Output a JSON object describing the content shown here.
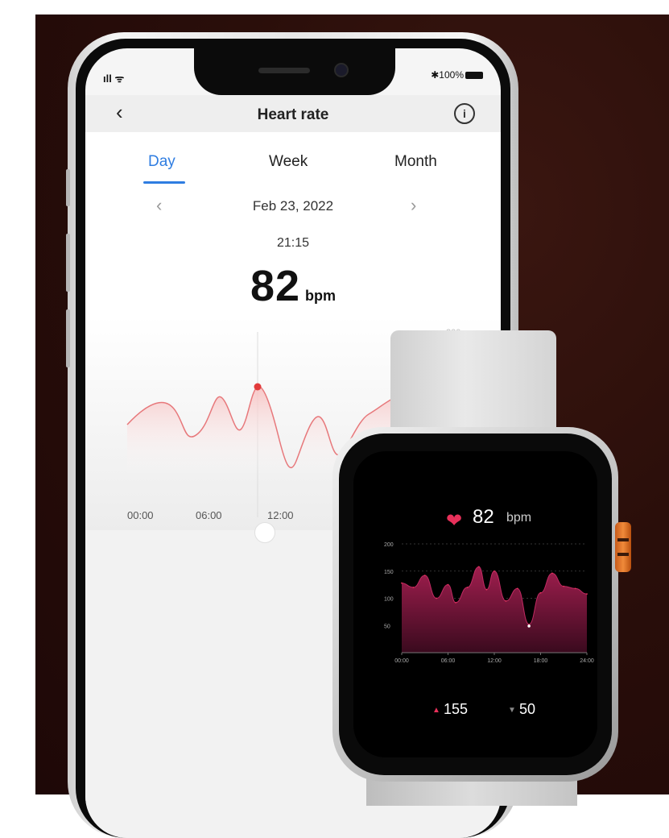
{
  "status_bar": {
    "signal": "ıll ᯤ",
    "battery": "✱100%"
  },
  "header": {
    "back_icon": "‹",
    "title": "Heart rate",
    "info_icon": "i"
  },
  "tabs": [
    {
      "label": "Day",
      "active": true
    },
    {
      "label": "Week"
    },
    {
      "label": "Month"
    }
  ],
  "date_nav": {
    "prev": "‹",
    "date": "Feb 23, 2022",
    "next": "›"
  },
  "reading": {
    "time": "21:15",
    "value": "82",
    "unit": "bpm"
  },
  "chart": {
    "x_ticks": [
      "00:00",
      "06:00",
      "12:00"
    ],
    "y_partial": "200",
    "line_color": "#e7787b",
    "fill_color": "#f9d3d3"
  },
  "watch": {
    "heart_icon": "❤",
    "value": "82",
    "unit": "bpm",
    "chart_data": {
      "type": "area",
      "y_ticks": [
        "200",
        "150",
        "100",
        "50"
      ],
      "x_ticks": [
        "00:00",
        "06:00",
        "12:00",
        "18:00",
        "24:00"
      ],
      "ylim": [
        0,
        200
      ],
      "x": [
        0,
        1.5,
        3,
        4.5,
        6,
        7,
        8.5,
        10,
        11,
        12,
        13.5,
        15,
        16.5,
        18,
        19.5,
        21,
        22.5,
        24
      ],
      "values": [
        128,
        120,
        142,
        100,
        125,
        92,
        120,
        158,
        116,
        150,
        95,
        118,
        52,
        110,
        146,
        122,
        118,
        108
      ],
      "fill_color": "#a01e4e"
    },
    "max_value": "155",
    "min_value": "50",
    "accent": "#e8305a"
  }
}
